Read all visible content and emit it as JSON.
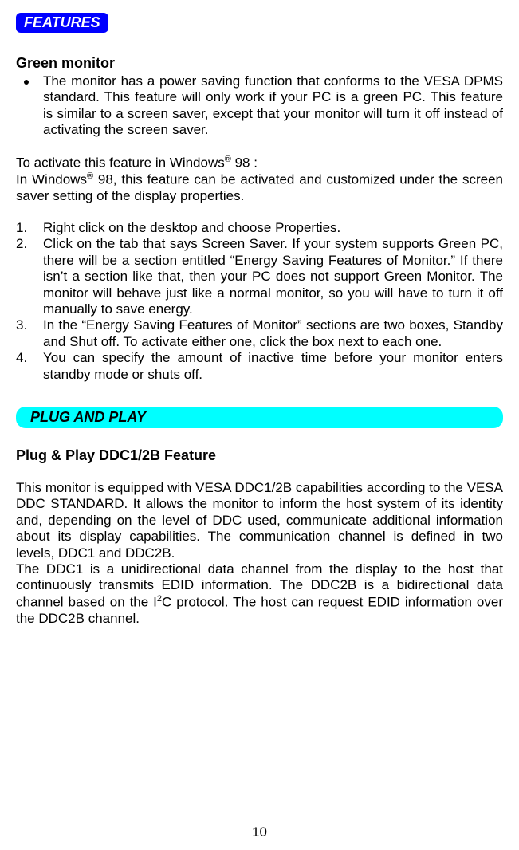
{
  "badge": {
    "features": "FEATURES"
  },
  "green": {
    "heading": "Green monitor",
    "bullet": "The monitor has a power saving function that conforms to the VESA DPMS standard. This feature will only work if your PC is a green PC. This feature is similar to a screen saver, except that your monitor will turn it off instead of activating the screen saver.",
    "activate_line_pre": "To activate this feature in Windows",
    "activate_line_post": " 98 :",
    "in_windows_pre": "In Windows",
    "in_windows_post": " 98, this feature can be activated and customized under the screen saver setting of the display properties.",
    "steps": [
      "Right click on the desktop and choose Properties.",
      "Click on the tab that says Screen Saver. If your system supports Green PC, there will be a section entitled “Energy Saving Features of Monitor.” If there isn’t a section like that, then your PC does not support Green Monitor. The monitor will behave just like a normal monitor, so you will have to turn it off manually to save energy.",
      "In the “Energy Saving Features of Monitor” sections are two boxes, Standby and Shut off. To activate either one, click the box next to each one.",
      "You can specify the amount of inactive time before your monitor enters standby mode or shuts off."
    ]
  },
  "plug": {
    "pill": "PLUG AND PLAY",
    "heading": "Plug & Play DDC1/2B Feature",
    "p1": "This monitor is equipped with VESA DDC1/2B capabilities according to the VESA DDC STANDARD. It allows the monitor to inform the host system of its identity and, depending on the level of DDC used, communicate additional information about its display capabilities. The communication channel is defined in two levels, DDC1 and DDC2B.",
    "p2_pre": "The DDC1 is a unidirectional data channel from the display to the host that continuously transmits EDID information. The DDC2B is a bidirectional data channel based on the I",
    "p2_post": "C protocol. The host can request EDID information over the DDC2B channel."
  },
  "page_number": "10",
  "reg_mark": "®",
  "sup2": "2"
}
